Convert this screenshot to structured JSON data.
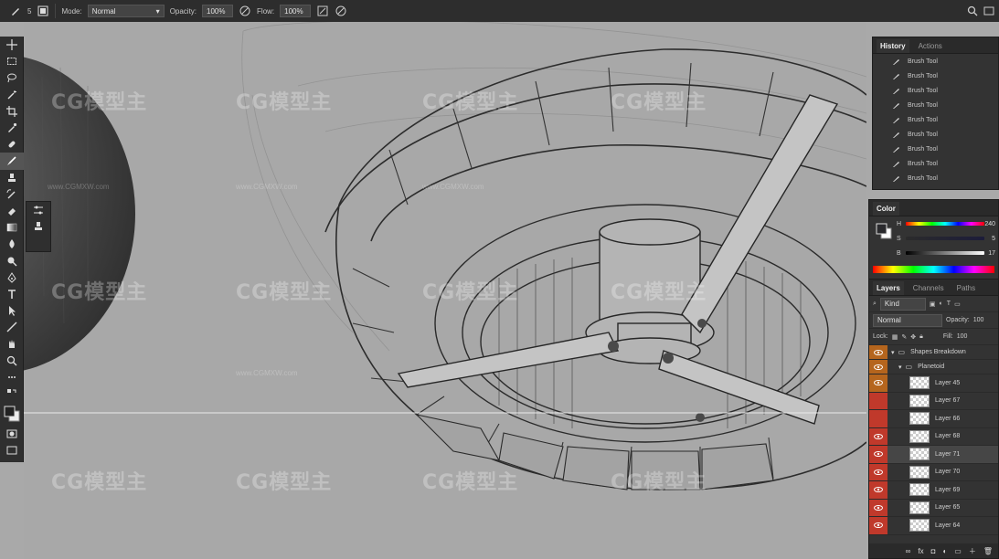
{
  "options_bar": {
    "brush_size": "5",
    "mode_label": "Mode:",
    "mode_value": "Normal",
    "opacity_label": "Opacity:",
    "opacity_value": "100%",
    "flow_label": "Flow:",
    "flow_value": "100%"
  },
  "history_panel": {
    "tabs": [
      "History",
      "Actions"
    ],
    "items": [
      "Brush Tool",
      "Brush Tool",
      "Brush Tool",
      "Brush Tool",
      "Brush Tool",
      "Brush Tool",
      "Brush Tool",
      "Brush Tool",
      "Brush Tool"
    ]
  },
  "color_panel": {
    "title": "Color",
    "h_label": "H",
    "h_value": "240",
    "s_label": "S",
    "s_value": "5",
    "b_label": "B",
    "b_value": "17"
  },
  "layers_panel": {
    "tabs": [
      "Layers",
      "Channels",
      "Paths"
    ],
    "filter_label": "Kind",
    "blend_mode": "Normal",
    "opacity_label": "Opacity:",
    "opacity_value": "100",
    "lock_label": "Lock:",
    "fill_label": "Fill:",
    "fill_value": "100",
    "group_top": "Shapes Breakdown",
    "group_sub": "Planetoid",
    "layers": [
      "Layer 45",
      "Layer 67",
      "Layer 66",
      "Layer 68",
      "Layer 71",
      "Layer 70",
      "Layer 69",
      "Layer 65",
      "Layer 64"
    ],
    "footer_fx": "fx"
  },
  "watermark": {
    "text": "CG模型主",
    "url": "www.CGMXW.com"
  },
  "colors": {
    "eye_active": "#c0392b",
    "eye_group": "#b5651d",
    "panel_bg": "#333333",
    "canvas_bg": "#a8a8a8"
  }
}
